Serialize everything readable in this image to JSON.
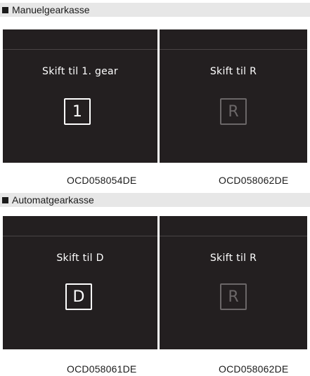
{
  "sections": [
    {
      "title": "Manuelgearkasse",
      "panels": [
        {
          "message": "Skift til 1. gear",
          "gear": "1",
          "state": "active",
          "code": "OCD058054DE"
        },
        {
          "message": "Skift til R",
          "gear": "R",
          "state": "inactive",
          "code": "OCD058062DE"
        }
      ]
    },
    {
      "title": "Automatgearkasse",
      "panels": [
        {
          "message": "Skift til D",
          "gear": "D",
          "state": "active",
          "code": "OCD058061DE"
        },
        {
          "message": "Skift til R",
          "gear": "R",
          "state": "inactive",
          "code": "OCD058062DE"
        }
      ]
    }
  ],
  "colors": {
    "panel_bg": "#231f20",
    "active_gear": "#ffffff",
    "inactive_gear": "#6b6768",
    "header_bg": "#e7e7e7"
  }
}
